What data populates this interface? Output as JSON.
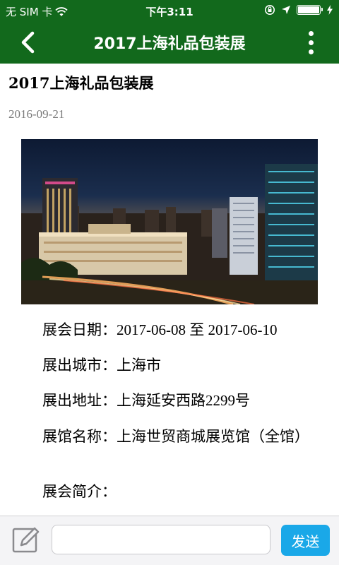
{
  "status_bar": {
    "carrier": "无 SIM 卡",
    "time": "下午3:11"
  },
  "nav": {
    "title": "2017上海礼品包装展"
  },
  "article": {
    "title": "2017上海礼品包装展",
    "date": "2016-09-21",
    "details": [
      "展会日期：2017-06-08 至 2017-06-10",
      "展出城市：上海市",
      "展出地址：上海延安西路2299号",
      "展馆名称：上海世贸商城展览馆（全馆）",
      "展会简介："
    ]
  },
  "bottom_bar": {
    "input_value": "",
    "send_label": "发送"
  },
  "colors": {
    "header_green": "#12691c",
    "send_blue": "#1aa8e8"
  }
}
